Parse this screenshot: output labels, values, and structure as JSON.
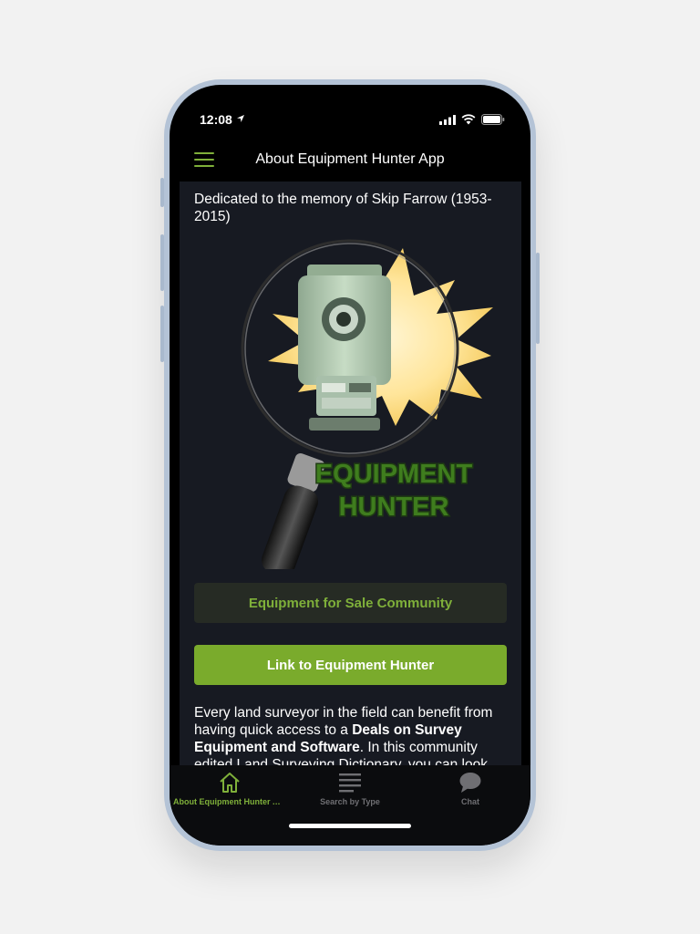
{
  "status_bar": {
    "time": "12:08"
  },
  "nav": {
    "title": "About Equipment Hunter App"
  },
  "content": {
    "dedication": "Dedicated to the memory of Skip Farrow (1953-2015)",
    "logo_line1": "EQUIPMENT",
    "logo_line2": "HUNTER",
    "community_button": "Equipment for Sale Community",
    "link_button": "Link to Equipment Hunter",
    "desc_part1": "Every land surveyor in the field can benefit from having quick access to a ",
    "desc_bold": "Deals on Survey Equipment and Software",
    "desc_part2": ".  In this community edited Land Surveying Dictionary, you can look"
  },
  "tabs": [
    {
      "label": "About Equipment Hunter App",
      "icon": "home-icon",
      "active": true
    },
    {
      "label": "Search by Type",
      "icon": "list-icon",
      "active": false
    },
    {
      "label": "Chat",
      "icon": "chat-icon",
      "active": false
    }
  ],
  "colors": {
    "accent": "#7fb03a",
    "button_green": "#7aab2c",
    "content_bg": "#171a22",
    "community_button_bg": "#262b24",
    "inactive_tab": "#6f6f73"
  }
}
